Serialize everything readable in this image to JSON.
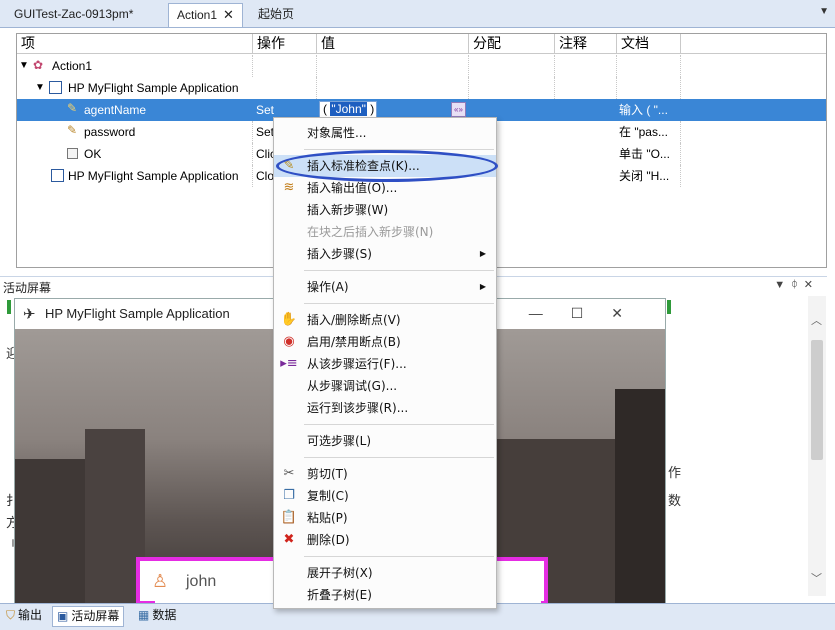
{
  "doc_tabs": [
    {
      "label": "GUITest-Zac-0913pm*"
    },
    {
      "label": "Action1"
    },
    {
      "label": "起始页"
    }
  ],
  "grid": {
    "columns": [
      "项",
      "操作",
      "值",
      "分配",
      "注释",
      "文档"
    ],
    "rows": [
      {
        "item": "Action1",
        "operation": "",
        "value": "",
        "doc": ""
      },
      {
        "item": "HP MyFlight Sample Application",
        "operation": "",
        "value": "",
        "doc": ""
      },
      {
        "item": "agentName",
        "operation": "Set",
        "value": "\"John\"",
        "doc": "输入 ( \"..."
      },
      {
        "item": "password",
        "operation": "Set",
        "value": "",
        "doc": "在 \"pas..."
      },
      {
        "item": "OK",
        "operation": "Clic",
        "value": "",
        "doc": "单击 \"O..."
      },
      {
        "item": "HP MyFlight Sample Application",
        "operation": "Clo",
        "value": "",
        "doc": "关闭 \"H..."
      }
    ],
    "param_button": "«»"
  },
  "active_screen": {
    "title": "活动屏幕",
    "app_title": "HP MyFlight Sample Application",
    "login_value": "john",
    "side_fragments": [
      "迎",
      "扌",
      "方",
      "刂",
      "作",
      "数"
    ]
  },
  "bottom_tabs": [
    {
      "label": "输出"
    },
    {
      "label": "活动屏幕"
    },
    {
      "label": "数据"
    }
  ],
  "context_menu": {
    "items": [
      {
        "label": "对象属性..."
      },
      {
        "label": "插入标准检查点(K)..."
      },
      {
        "label": "插入输出值(O)..."
      },
      {
        "label": "插入新步骤(W)"
      },
      {
        "label": "在块之后插入新步骤(N)"
      },
      {
        "label": "插入步骤(S)"
      },
      {
        "label": "操作(A)"
      },
      {
        "label": "插入/删除断点(V)"
      },
      {
        "label": "启用/禁用断点(B)"
      },
      {
        "label": "从该步骤运行(F)..."
      },
      {
        "label": "从步骤调试(G)..."
      },
      {
        "label": "运行到该步骤(R)..."
      },
      {
        "label": "可选步骤(L)"
      },
      {
        "label": "剪切(T)"
      },
      {
        "label": "复制(C)"
      },
      {
        "label": "粘贴(P)"
      },
      {
        "label": "删除(D)"
      },
      {
        "label": "展开子树(X)"
      },
      {
        "label": "折叠子树(E)"
      }
    ]
  },
  "colors": {
    "selection": "#3a86d6",
    "highlight_circle": "#2f4fc4",
    "login_border": "#e52ce3"
  }
}
